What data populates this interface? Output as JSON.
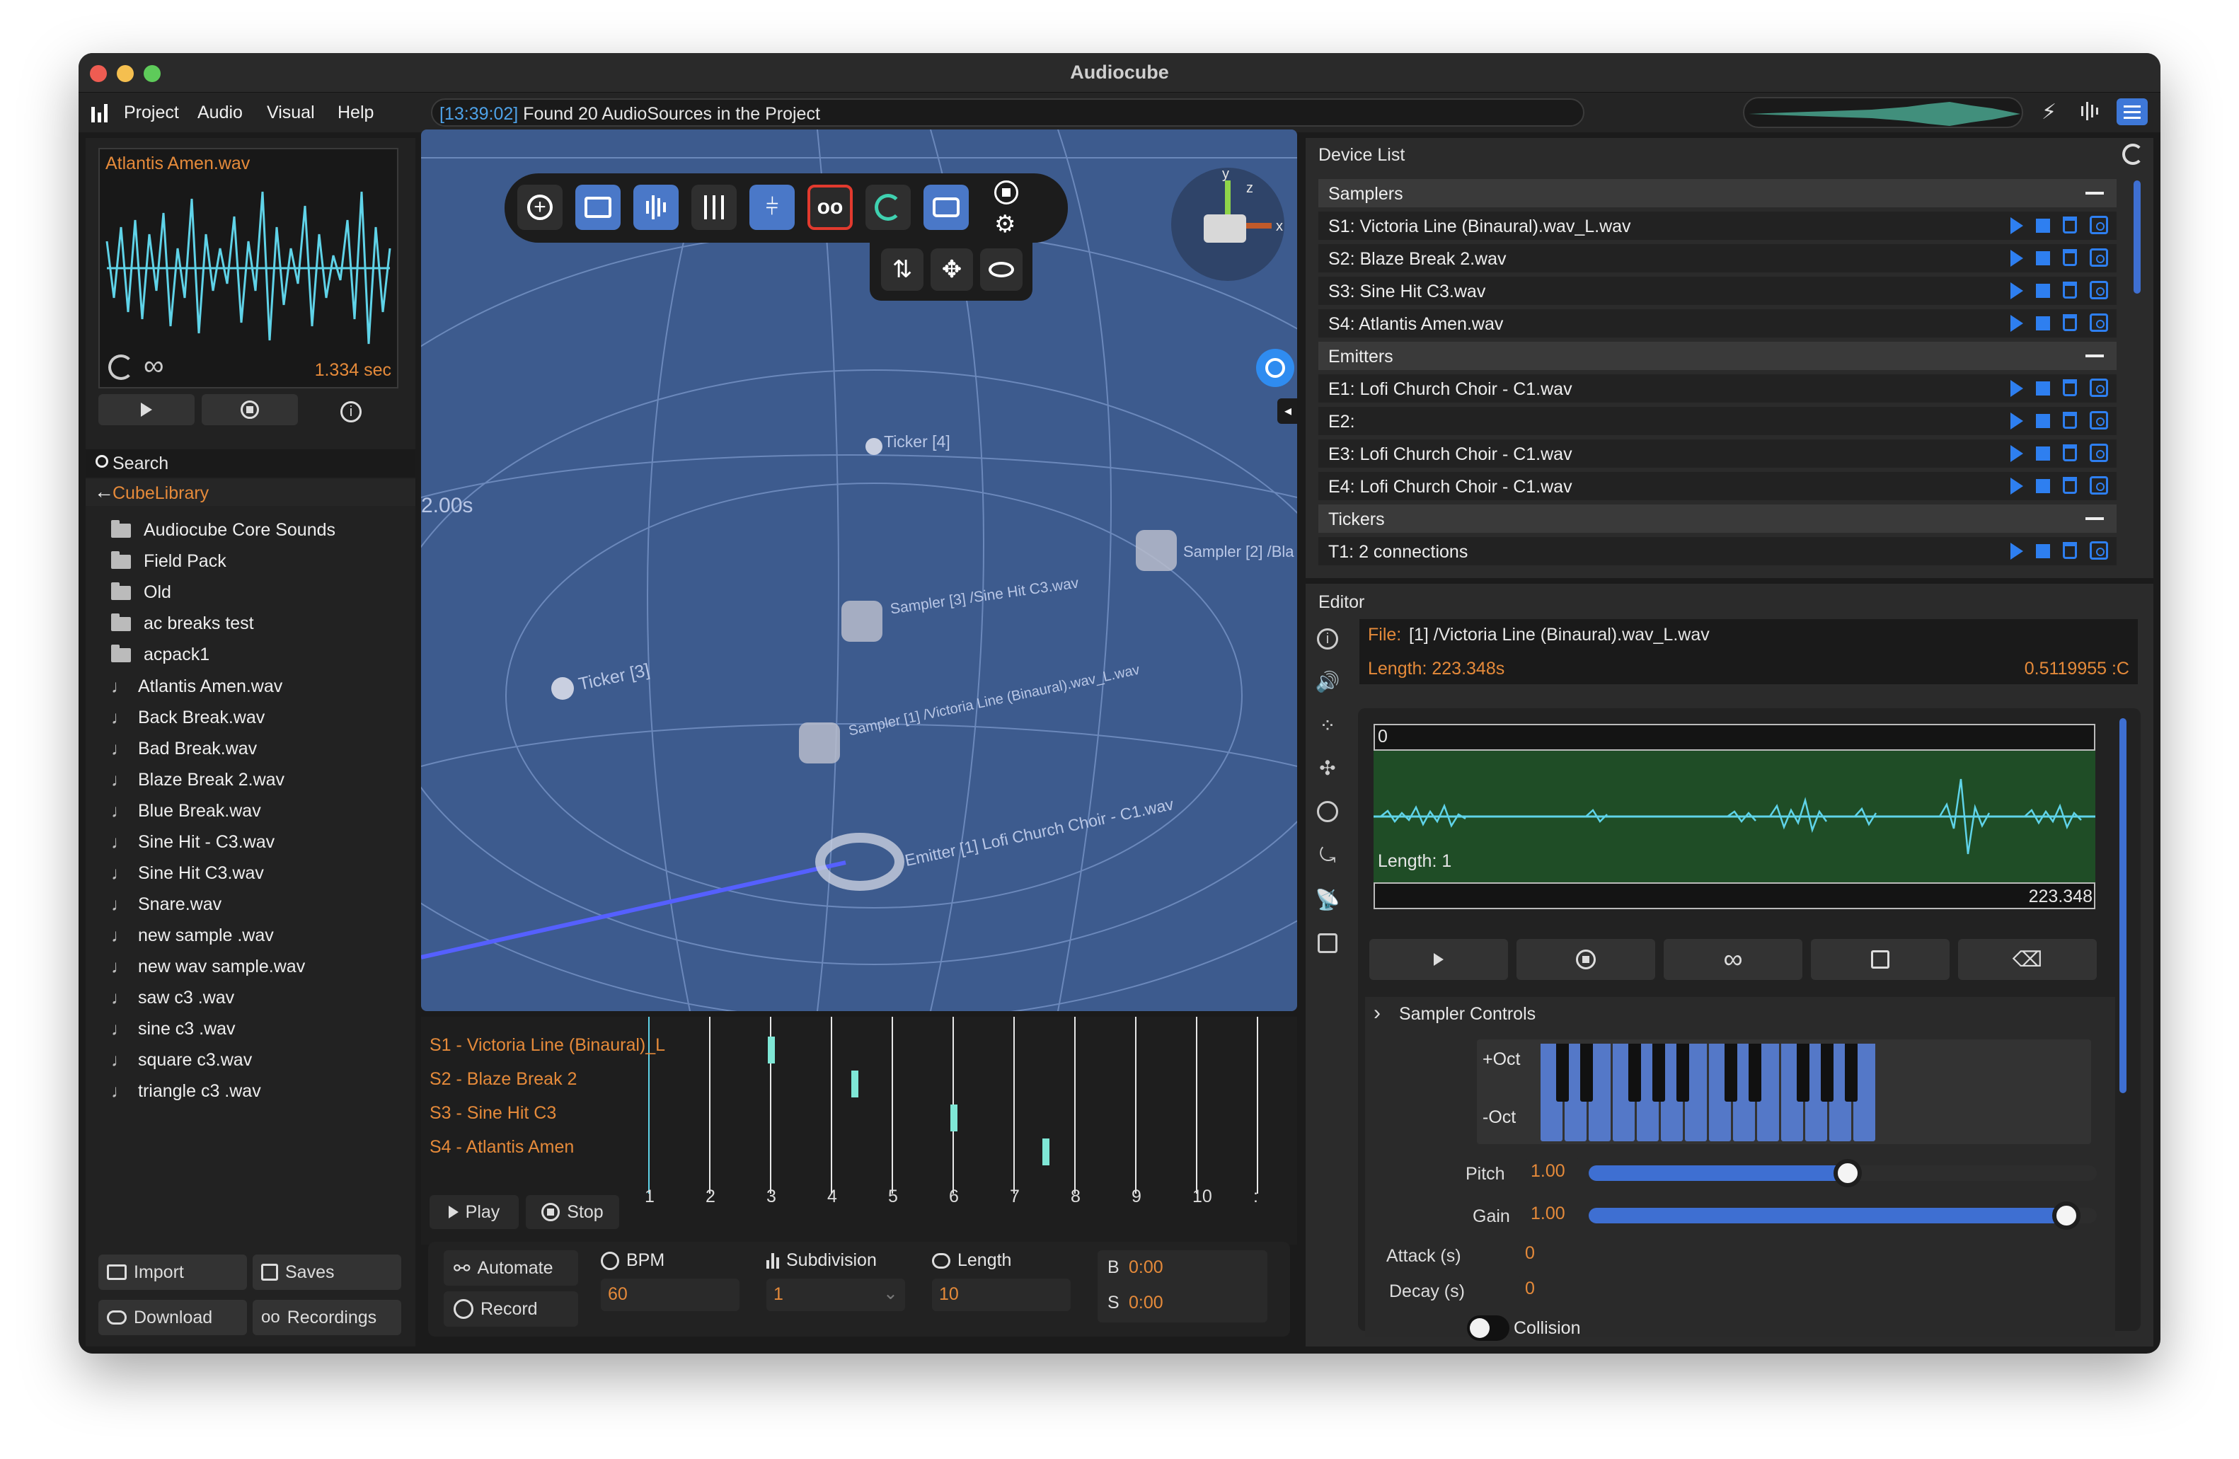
{
  "window": {
    "title": "Audiocube"
  },
  "menu": {
    "items": [
      "Project",
      "Audio",
      "Visual",
      "Help"
    ]
  },
  "status": {
    "time": "[13:39:02]",
    "message": "Found 20 AudioSources in the Project"
  },
  "preview": {
    "filename": "Atlantis Amen.wav",
    "duration": "1.334 sec"
  },
  "library": {
    "search_label": "Search",
    "breadcrumb": "CubeLibrary",
    "folders": [
      "Audiocube Core Sounds",
      "Field Pack",
      "Old",
      "ac breaks test",
      "acpack1"
    ],
    "files": [
      "Atlantis Amen.wav",
      "Back Break.wav",
      "Bad Break.wav",
      "Blaze Break 2.wav",
      "Blue Break.wav",
      "Sine Hit - C3.wav",
      "Sine Hit C3.wav",
      "Snare.wav",
      "new sample .wav",
      "new wav sample.wav",
      "saw c3 .wav",
      "sine c3 .wav",
      "square c3.wav",
      "triangle c3 .wav"
    ]
  },
  "bottom_left": {
    "import": "Import",
    "saves": "Saves",
    "download": "Download",
    "recordings": "Recordings"
  },
  "scene": {
    "labels": {
      "ticker4": "Ticker [4]",
      "ticker3": "Ticker [3]",
      "sampler2": "Sampler [2] /Bla",
      "sampler3": "Sampler [3] /Sine Hit C3.wav",
      "sampler1": "Sampler [1] /Victoria Line (Binaural).wav_L.wav",
      "emitter1": "Emitter [1] Lofi Church Choir - C1.wav",
      "grid_label": "2.00s"
    },
    "gizmo": {
      "x": "x",
      "y": "y",
      "z": "z"
    }
  },
  "sequencer": {
    "tracks": [
      "S1 - Victoria Line (Binaural)_L",
      "S2 - Blaze Break 2",
      "S3 - Sine Hit C3",
      "S4 - Atlantis Amen"
    ],
    "beats": [
      "1",
      "2",
      "3",
      "4",
      "5",
      "6",
      "7",
      "8",
      "9",
      "10",
      ":"
    ],
    "play": "Play",
    "stop": "Stop"
  },
  "transport": {
    "automate": "Automate",
    "record": "Record",
    "bpm_label": "BPM",
    "bpm": "60",
    "subdivision_label": "Subdivision",
    "subdivision": "1",
    "length_label": "Length",
    "length": "10",
    "b_label": "B",
    "b_value": "0:00",
    "s_label": "S",
    "s_value": "0:00"
  },
  "device_list": {
    "title": "Device List",
    "samplers_label": "Samplers",
    "samplers": [
      "S1: Victoria Line (Binaural).wav_L.wav",
      "S2: Blaze Break 2.wav",
      "S3: Sine Hit C3.wav",
      "S4: Atlantis Amen.wav"
    ],
    "emitters_label": "Emitters",
    "emitters": [
      "E1: Lofi Church Choir - C1.wav",
      "E2:",
      "E3: Lofi Church Choir - C1.wav",
      "E4: Lofi Church Choir - C1.wav"
    ],
    "tickers_label": "Tickers",
    "tickers": [
      "T1: 2 connections"
    ]
  },
  "editor": {
    "title": "Editor",
    "file_label": "File:",
    "file": "[1] /Victoria Line (Binaural).wav_L.wav",
    "length_text": "Length: 223.348s",
    "position_text": "0.5119955 :C",
    "wave_start": "0",
    "wave_length": "Length: 1",
    "wave_end": "223.348",
    "sampler_controls": "Sampler Controls",
    "oct_up": "+Oct",
    "oct_down": "-Oct",
    "pitch_label": "Pitch",
    "pitch": "1.00",
    "pitch_level": 0.51,
    "gain_label": "Gain",
    "gain": "1.00",
    "gain_level": 0.94,
    "attack_label": "Attack (s)",
    "attack": "0",
    "decay_label": "Decay (s)",
    "decay": "0",
    "collision_label": "Collision"
  },
  "colors": {
    "accent": "#2e7ff0",
    "orange": "#e58a3a",
    "scene_bg": "#3c5a8c",
    "wave": "#5fd3e8",
    "editor_wave_bg": "#1f4d26"
  }
}
